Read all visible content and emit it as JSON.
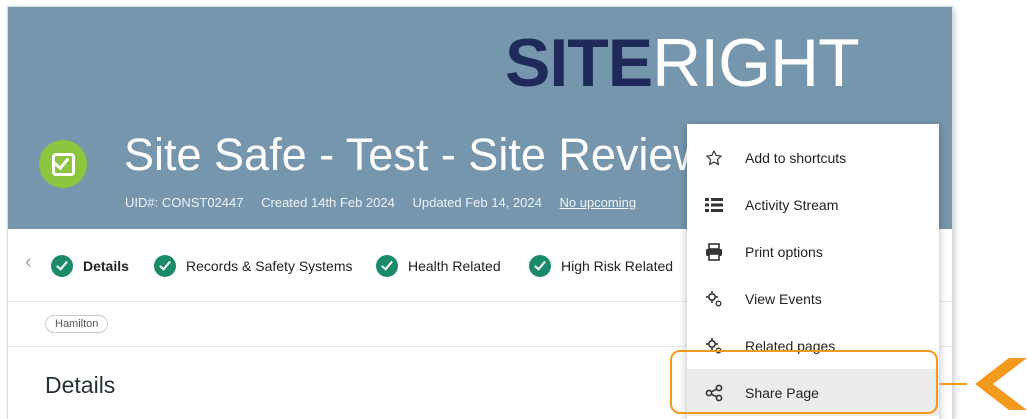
{
  "header": {
    "logo_bold": "SITE",
    "logo_light": "RIGHT",
    "title": "Site Safe - Test - Site Review",
    "meta": {
      "uid": "UID#: CONST02447",
      "created": "Created 14th Feb 2024",
      "updated": "Updated Feb 14, 2024",
      "upcoming": "No upcoming"
    }
  },
  "tabs": {
    "prev_arrow": "‹",
    "next_arrow": "›",
    "items": [
      {
        "label": "Details"
      },
      {
        "label": "Records & Safety Systems"
      },
      {
        "label": "Health Related"
      },
      {
        "label": "High Risk Related"
      }
    ]
  },
  "chip": "Hamilton",
  "section_title": "Details",
  "menu": {
    "items": [
      {
        "label": "Add to shortcuts",
        "icon": "star-outline-icon"
      },
      {
        "label": "Activity Stream",
        "icon": "list-icon"
      },
      {
        "label": "Print options",
        "icon": "printer-icon"
      },
      {
        "label": "View Events",
        "icon": "gears-icon"
      },
      {
        "label": "Related pages",
        "icon": "gears-icon"
      },
      {
        "label": "Share Page",
        "icon": "share-icon"
      }
    ],
    "highlighted": "Share Page"
  },
  "colors": {
    "banner": "#7696ad",
    "logo_dark": "#1f2a5b",
    "check_green": "#1b8a6b",
    "page_icon_green": "#8cc63f",
    "callout_orange": "#f39a1e"
  }
}
